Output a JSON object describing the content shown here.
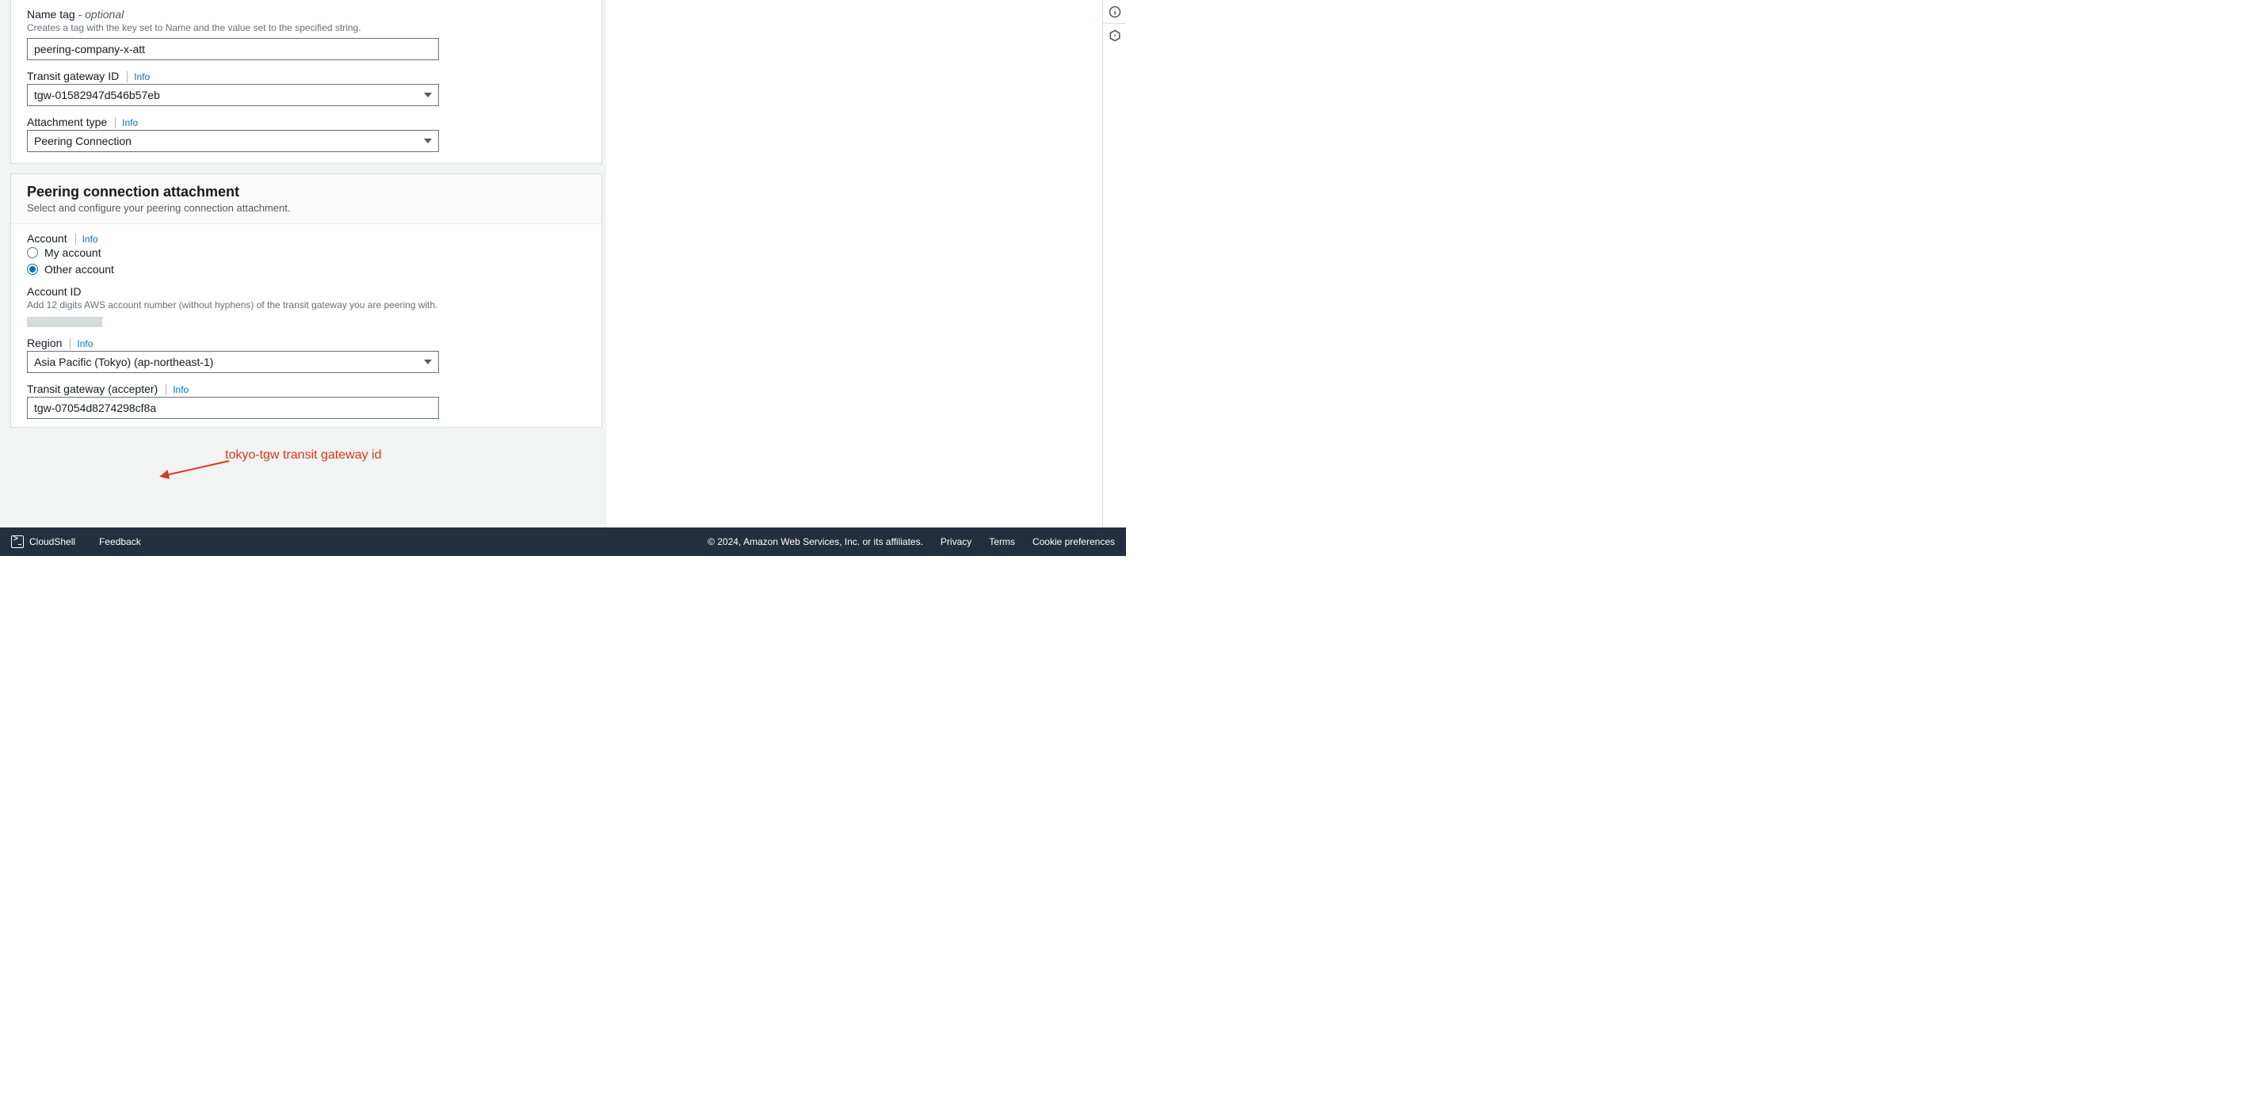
{
  "info_label": "Info",
  "panel1": {
    "name_tag": {
      "label": "Name tag",
      "optional": "- optional",
      "help": "Creates a tag with the key set to Name and the value set to the specified string.",
      "value": "peering-company-x-att"
    },
    "tgw_id": {
      "label": "Transit gateway ID",
      "value": "tgw-01582947d546b57eb"
    },
    "att_type": {
      "label": "Attachment type",
      "value": "Peering Connection"
    }
  },
  "panel2": {
    "title": "Peering connection attachment",
    "desc": "Select and configure your peering connection attachment.",
    "account": {
      "label": "Account",
      "opt_my": "My account",
      "opt_other": "Other account",
      "selected": "other"
    },
    "account_id": {
      "label": "Account ID",
      "help": "Add 12 digits AWS account number (without hyphens) of the transit gateway you are peering with.",
      "value": ""
    },
    "region": {
      "label": "Region",
      "value": "Asia Pacific (Tokyo) (ap-northeast-1)"
    },
    "accepter": {
      "label": "Transit gateway (accepter)",
      "value": "tgw-07054d8274298cf8a"
    }
  },
  "annotation": {
    "text": "tokyo-tgw transit gateway id"
  },
  "footer": {
    "cloudshell": "CloudShell",
    "feedback": "Feedback",
    "copyright": "© 2024, Amazon Web Services, Inc. or its affiliates.",
    "privacy": "Privacy",
    "terms": "Terms",
    "cookie": "Cookie preferences"
  }
}
